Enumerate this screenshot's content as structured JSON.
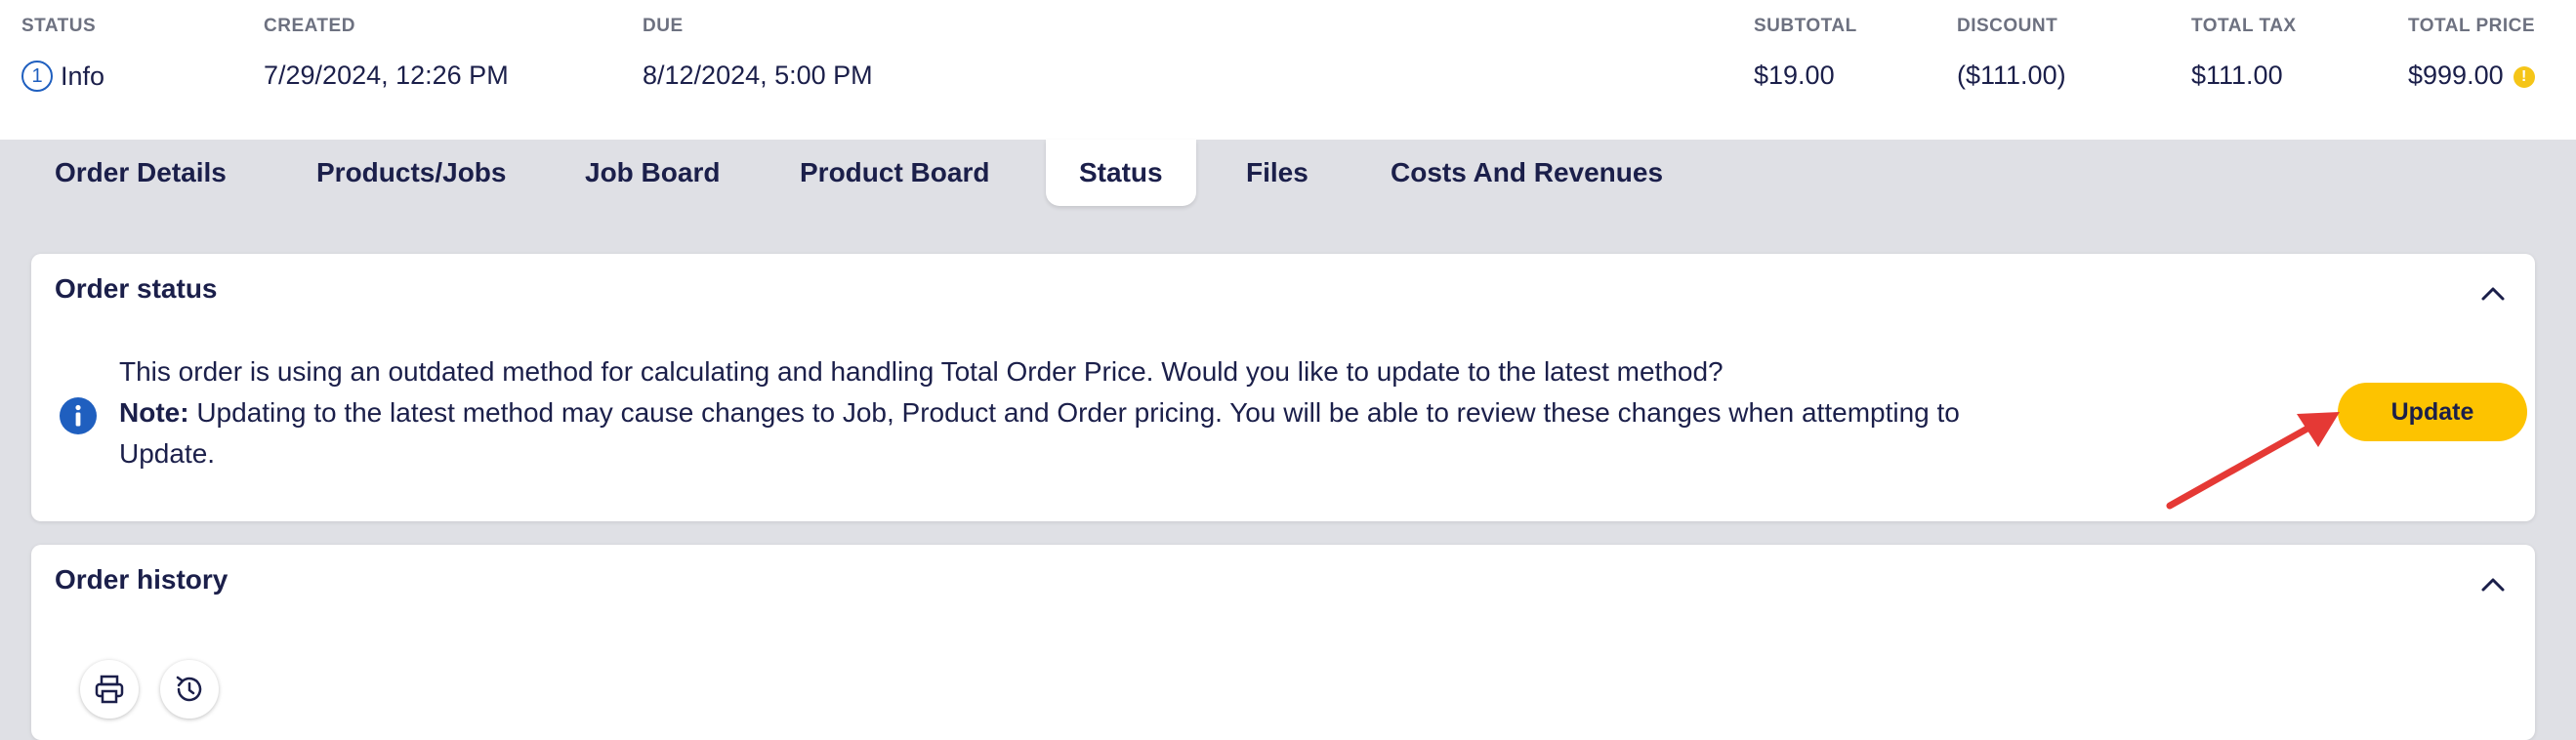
{
  "summary": {
    "status": {
      "label": "STATUS",
      "step": "1",
      "value": "Info"
    },
    "created": {
      "label": "CREATED",
      "value": "7/29/2024, 12:26 PM"
    },
    "due": {
      "label": "DUE",
      "value": "8/12/2024, 5:00 PM"
    },
    "subtotal": {
      "label": "SUBTOTAL",
      "value": "$19.00"
    },
    "discount": {
      "label": "DISCOUNT",
      "value": "($111.00)"
    },
    "total_tax": {
      "label": "TOTAL TAX",
      "value": "$111.00"
    },
    "total_price": {
      "label": "TOTAL PRICE",
      "value": "$999.00",
      "warning_glyph": "!"
    }
  },
  "tabs": [
    {
      "label": "Order Details"
    },
    {
      "label": "Products/Jobs"
    },
    {
      "label": "Job Board"
    },
    {
      "label": "Product Board"
    },
    {
      "label": "Status",
      "active": true
    },
    {
      "label": "Files"
    },
    {
      "label": "Costs And Revenues"
    }
  ],
  "order_status": {
    "title": "Order status",
    "message_line1": "This order is using an outdated method for calculating and handling Total Order Price. Would you like to update to the latest method?",
    "note_label": "Note:",
    "note_text": " Updating to the latest method may cause changes to Job, Product and Order pricing. You will be able to review these changes when attempting to Update.",
    "update_button": "Update"
  },
  "order_history": {
    "title": "Order history",
    "icons": [
      "printer-icon",
      "history-icon"
    ]
  },
  "colors": {
    "accent_yellow": "#fdc300",
    "info_blue": "#1f5fbf",
    "arrow_red": "#e53935",
    "text_navy": "#1b1f4a",
    "background": "#dfe0e5"
  }
}
